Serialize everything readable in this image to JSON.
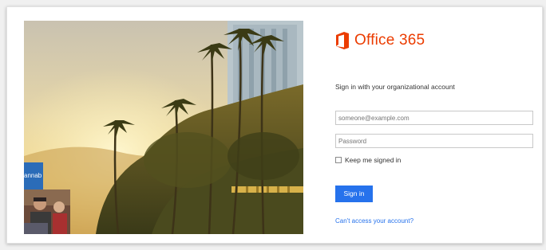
{
  "brand": {
    "name": "Office 365",
    "icon": "office-logo-icon",
    "color": "#eb3c00"
  },
  "signin": {
    "heading": "Sign in with your organizational account",
    "email_placeholder": "someone@example.com",
    "password_placeholder": "Password",
    "keep_signed_in_label": "Keep me signed in",
    "keep_signed_in_checked": false,
    "signin_button_label": "Sign in",
    "cant_access_link": "Can't access your account?",
    "accent": "#2672ec"
  },
  "background": {
    "tile_text": "annab",
    "scene": "palm trees and buildings at sunset"
  }
}
